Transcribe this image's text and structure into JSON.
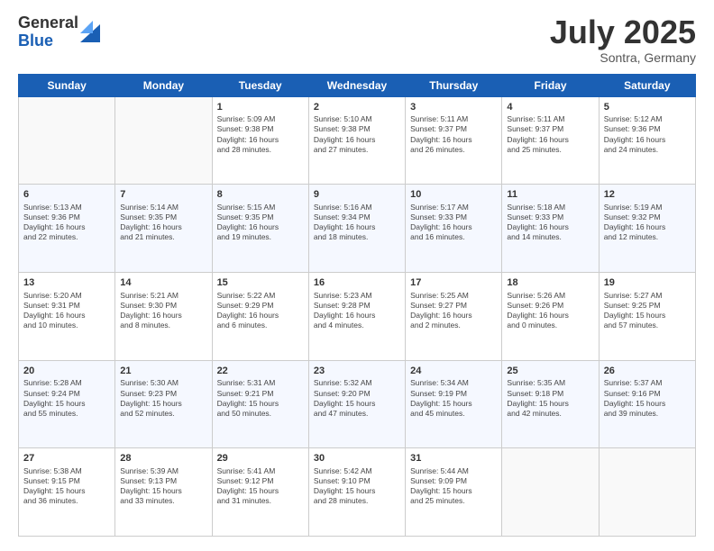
{
  "header": {
    "logo_general": "General",
    "logo_blue": "Blue",
    "month": "July 2025",
    "location": "Sontra, Germany"
  },
  "days_of_week": [
    "Sunday",
    "Monday",
    "Tuesday",
    "Wednesday",
    "Thursday",
    "Friday",
    "Saturday"
  ],
  "weeks": [
    [
      {
        "num": "",
        "info": ""
      },
      {
        "num": "",
        "info": ""
      },
      {
        "num": "1",
        "info": "Sunrise: 5:09 AM\nSunset: 9:38 PM\nDaylight: 16 hours\nand 28 minutes."
      },
      {
        "num": "2",
        "info": "Sunrise: 5:10 AM\nSunset: 9:38 PM\nDaylight: 16 hours\nand 27 minutes."
      },
      {
        "num": "3",
        "info": "Sunrise: 5:11 AM\nSunset: 9:37 PM\nDaylight: 16 hours\nand 26 minutes."
      },
      {
        "num": "4",
        "info": "Sunrise: 5:11 AM\nSunset: 9:37 PM\nDaylight: 16 hours\nand 25 minutes."
      },
      {
        "num": "5",
        "info": "Sunrise: 5:12 AM\nSunset: 9:36 PM\nDaylight: 16 hours\nand 24 minutes."
      }
    ],
    [
      {
        "num": "6",
        "info": "Sunrise: 5:13 AM\nSunset: 9:36 PM\nDaylight: 16 hours\nand 22 minutes."
      },
      {
        "num": "7",
        "info": "Sunrise: 5:14 AM\nSunset: 9:35 PM\nDaylight: 16 hours\nand 21 minutes."
      },
      {
        "num": "8",
        "info": "Sunrise: 5:15 AM\nSunset: 9:35 PM\nDaylight: 16 hours\nand 19 minutes."
      },
      {
        "num": "9",
        "info": "Sunrise: 5:16 AM\nSunset: 9:34 PM\nDaylight: 16 hours\nand 18 minutes."
      },
      {
        "num": "10",
        "info": "Sunrise: 5:17 AM\nSunset: 9:33 PM\nDaylight: 16 hours\nand 16 minutes."
      },
      {
        "num": "11",
        "info": "Sunrise: 5:18 AM\nSunset: 9:33 PM\nDaylight: 16 hours\nand 14 minutes."
      },
      {
        "num": "12",
        "info": "Sunrise: 5:19 AM\nSunset: 9:32 PM\nDaylight: 16 hours\nand 12 minutes."
      }
    ],
    [
      {
        "num": "13",
        "info": "Sunrise: 5:20 AM\nSunset: 9:31 PM\nDaylight: 16 hours\nand 10 minutes."
      },
      {
        "num": "14",
        "info": "Sunrise: 5:21 AM\nSunset: 9:30 PM\nDaylight: 16 hours\nand 8 minutes."
      },
      {
        "num": "15",
        "info": "Sunrise: 5:22 AM\nSunset: 9:29 PM\nDaylight: 16 hours\nand 6 minutes."
      },
      {
        "num": "16",
        "info": "Sunrise: 5:23 AM\nSunset: 9:28 PM\nDaylight: 16 hours\nand 4 minutes."
      },
      {
        "num": "17",
        "info": "Sunrise: 5:25 AM\nSunset: 9:27 PM\nDaylight: 16 hours\nand 2 minutes."
      },
      {
        "num": "18",
        "info": "Sunrise: 5:26 AM\nSunset: 9:26 PM\nDaylight: 16 hours\nand 0 minutes."
      },
      {
        "num": "19",
        "info": "Sunrise: 5:27 AM\nSunset: 9:25 PM\nDaylight: 15 hours\nand 57 minutes."
      }
    ],
    [
      {
        "num": "20",
        "info": "Sunrise: 5:28 AM\nSunset: 9:24 PM\nDaylight: 15 hours\nand 55 minutes."
      },
      {
        "num": "21",
        "info": "Sunrise: 5:30 AM\nSunset: 9:23 PM\nDaylight: 15 hours\nand 52 minutes."
      },
      {
        "num": "22",
        "info": "Sunrise: 5:31 AM\nSunset: 9:21 PM\nDaylight: 15 hours\nand 50 minutes."
      },
      {
        "num": "23",
        "info": "Sunrise: 5:32 AM\nSunset: 9:20 PM\nDaylight: 15 hours\nand 47 minutes."
      },
      {
        "num": "24",
        "info": "Sunrise: 5:34 AM\nSunset: 9:19 PM\nDaylight: 15 hours\nand 45 minutes."
      },
      {
        "num": "25",
        "info": "Sunrise: 5:35 AM\nSunset: 9:18 PM\nDaylight: 15 hours\nand 42 minutes."
      },
      {
        "num": "26",
        "info": "Sunrise: 5:37 AM\nSunset: 9:16 PM\nDaylight: 15 hours\nand 39 minutes."
      }
    ],
    [
      {
        "num": "27",
        "info": "Sunrise: 5:38 AM\nSunset: 9:15 PM\nDaylight: 15 hours\nand 36 minutes."
      },
      {
        "num": "28",
        "info": "Sunrise: 5:39 AM\nSunset: 9:13 PM\nDaylight: 15 hours\nand 33 minutes."
      },
      {
        "num": "29",
        "info": "Sunrise: 5:41 AM\nSunset: 9:12 PM\nDaylight: 15 hours\nand 31 minutes."
      },
      {
        "num": "30",
        "info": "Sunrise: 5:42 AM\nSunset: 9:10 PM\nDaylight: 15 hours\nand 28 minutes."
      },
      {
        "num": "31",
        "info": "Sunrise: 5:44 AM\nSunset: 9:09 PM\nDaylight: 15 hours\nand 25 minutes."
      },
      {
        "num": "",
        "info": ""
      },
      {
        "num": "",
        "info": ""
      }
    ]
  ]
}
